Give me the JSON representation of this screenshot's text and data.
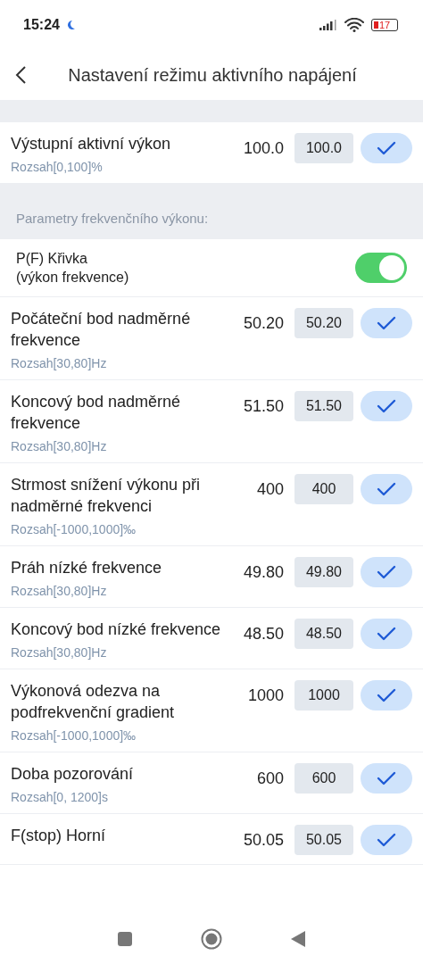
{
  "status_bar": {
    "time": "15:24",
    "battery": "17"
  },
  "header": {
    "title": "Nastavení režimu aktivního napájení"
  },
  "top_rows": [
    {
      "kind": "value",
      "title": "Výstupní aktivní výkon",
      "value": "100.0",
      "input": "100.0",
      "range": "Rozsah[0,100]%"
    }
  ],
  "section": {
    "label": "Parametry frekvenčního výkonu:"
  },
  "rows": [
    {
      "kind": "switch",
      "title": "P(F) Křivka\n(výkon frekvence)",
      "on": true
    },
    {
      "kind": "value",
      "title": "Počáteční bod nadměrné frekvence",
      "value": "50.20",
      "input": "50.20",
      "range": "Rozsah[30,80]Hz"
    },
    {
      "kind": "value",
      "title": "Koncový bod nadměrné frekvence",
      "value": "51.50",
      "input": "51.50",
      "range": "Rozsah[30,80]Hz"
    },
    {
      "kind": "value",
      "title": "Strmost snížení výkonu při nadměrné frekvenci",
      "value": "400",
      "input": "400",
      "range": "Rozsah[-1000,1000]‰"
    },
    {
      "kind": "value",
      "title": "Práh nízké frekvence",
      "value": "49.80",
      "input": "49.80",
      "range": "Rozsah[30,80]Hz"
    },
    {
      "kind": "value",
      "title": "Koncový bod nízké frekvence",
      "value": "48.50",
      "input": "48.50",
      "range": "Rozsah[30,80]Hz"
    },
    {
      "kind": "value",
      "title": "Výkonová odezva na podfrekvenční gradient",
      "value": "1000",
      "input": "1000",
      "range": "Rozsah[-1000,1000]‰"
    },
    {
      "kind": "value",
      "title": "Doba pozorování",
      "value": "600",
      "input": "600",
      "range": "Rozsah[0, 1200]s"
    },
    {
      "kind": "value",
      "title": "F(stop) Horní",
      "value": "50.05",
      "input": "50.05"
    }
  ]
}
